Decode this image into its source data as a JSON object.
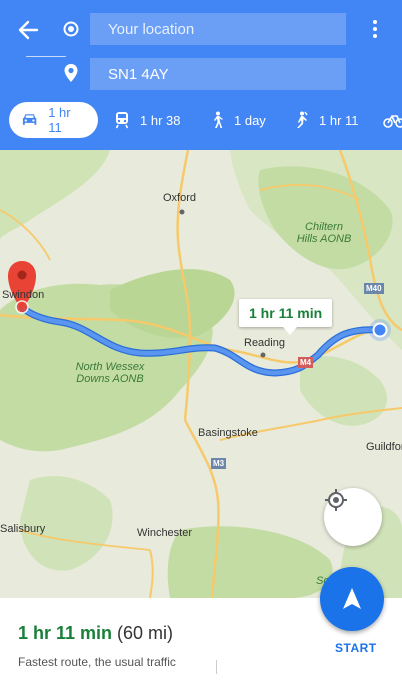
{
  "header": {
    "origin_placeholder": "Your location",
    "destination_value": "SN1 4AY"
  },
  "modes": [
    {
      "id": "drive",
      "label": "1 hr 11",
      "icon": "car-icon",
      "active": true
    },
    {
      "id": "transit",
      "label": "1 hr 38",
      "icon": "train-icon"
    },
    {
      "id": "walk",
      "label": "1 day",
      "icon": "walk-icon"
    },
    {
      "id": "ride",
      "label": "1 hr 11",
      "icon": "ride-icon"
    },
    {
      "id": "bike",
      "label": "",
      "icon": "bike-icon"
    }
  ],
  "map": {
    "places": {
      "oxford": "Oxford",
      "swindon": "Swindon",
      "reading": "Reading",
      "basingstoke": "Basingstoke",
      "guildford": "Guildfor",
      "salisbury": "Salisbury",
      "winchester": "Winchester",
      "southampton": "So"
    },
    "areas": {
      "chiltern": "Chiltern Hills AONB",
      "north_wessex": "North Wessex Downs AONB"
    },
    "roads": {
      "m4": "M4",
      "m3": "M3",
      "m40": "M40"
    },
    "route_duration": "1 hr 11 min",
    "route_color": "#4a8ae8"
  },
  "sheet": {
    "time": "1 hr 11 min",
    "distance": "(60 mi)",
    "description": "Fastest route, the usual traffic",
    "start_label": "START"
  },
  "colors": {
    "header": "#4285f4",
    "accent": "#1a73e8",
    "time_green": "#188038"
  }
}
